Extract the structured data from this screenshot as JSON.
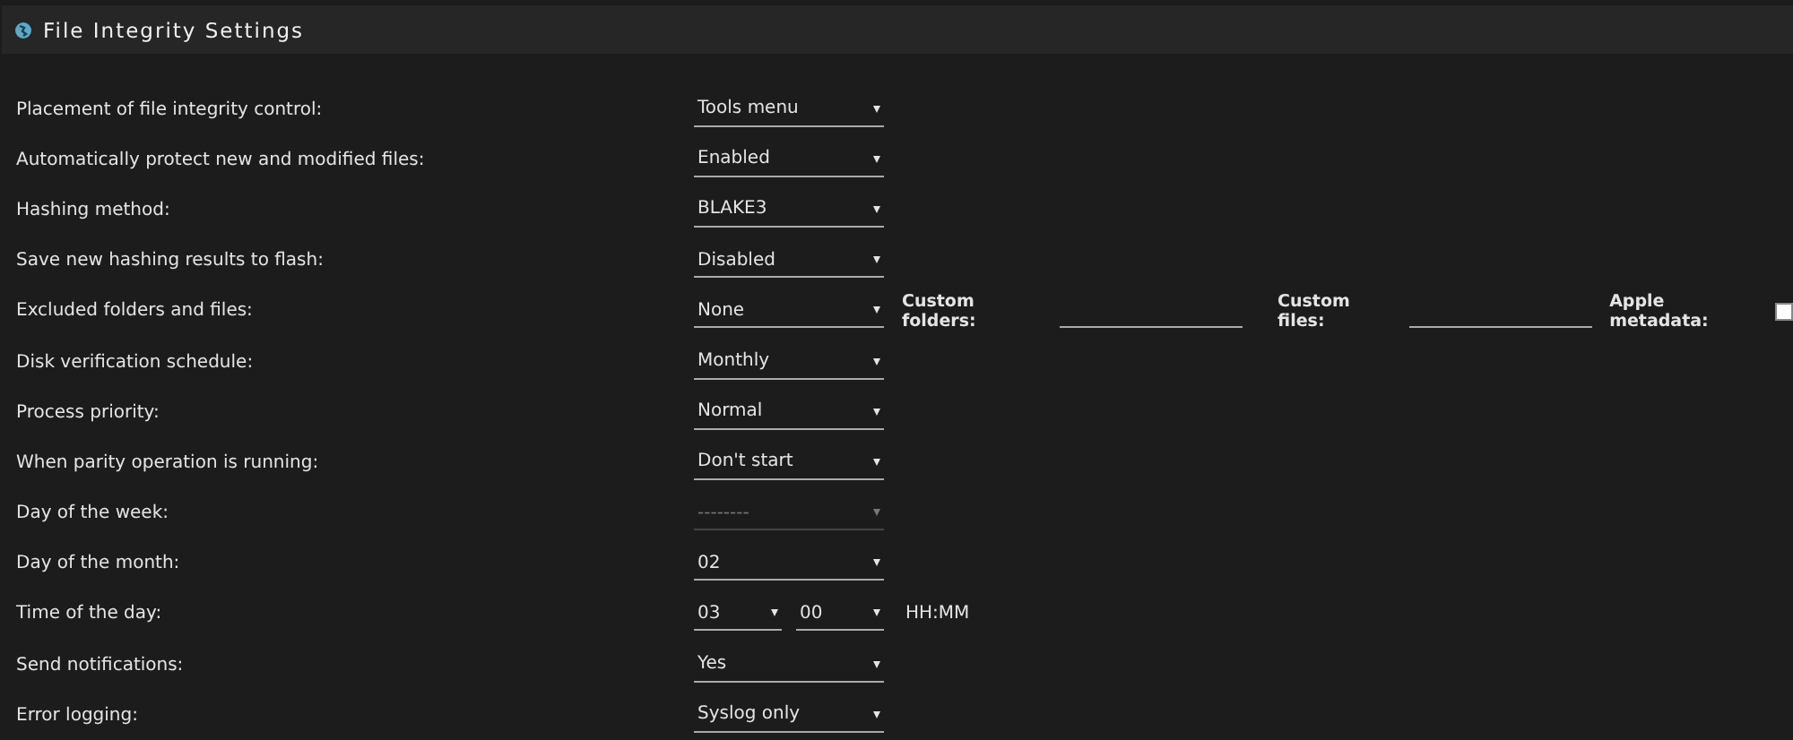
{
  "header": {
    "title": "File Integrity Settings"
  },
  "settings": [
    {
      "kind": "select",
      "label": "Placement of file integrity control:",
      "value": "Tools menu",
      "disabled": false
    },
    {
      "kind": "select",
      "label": "Automatically protect new and modified files:",
      "value": "Enabled",
      "disabled": false
    },
    {
      "kind": "select",
      "label": "Hashing method:",
      "value": "BLAKE3",
      "disabled": false
    },
    {
      "kind": "select",
      "label": "Save new hashing results to flash:",
      "value": "Disabled",
      "disabled": false
    },
    {
      "kind": "excluded",
      "label": "Excluded folders and files:",
      "value": "None",
      "disabled": false,
      "custom_folders": "Custom folders:",
      "custom_files": "Custom files:",
      "apple_metadata": {
        "label": "Apple metadata:",
        "checked": false
      }
    },
    {
      "kind": "select",
      "label": "Disk verification schedule:",
      "value": "Monthly",
      "disabled": false
    },
    {
      "kind": "select",
      "label": "Process priority:",
      "value": "Normal",
      "disabled": false
    },
    {
      "kind": "select",
      "label": "When parity operation is running:",
      "value": "Don't start",
      "disabled": false
    },
    {
      "kind": "select",
      "label": "Day of the week:",
      "value": "--------",
      "disabled": true
    },
    {
      "kind": "select",
      "label": "Day of the month:",
      "value": "02",
      "disabled": false
    },
    {
      "kind": "time",
      "label": "Time of the day:",
      "hour": "03",
      "minute": "00",
      "format": "HH:MM"
    },
    {
      "kind": "select",
      "label": "Send notifications:",
      "value": "Yes",
      "disabled": false
    },
    {
      "kind": "select",
      "label": "Error logging:",
      "value": "Syslog only",
      "disabled": false
    }
  ]
}
